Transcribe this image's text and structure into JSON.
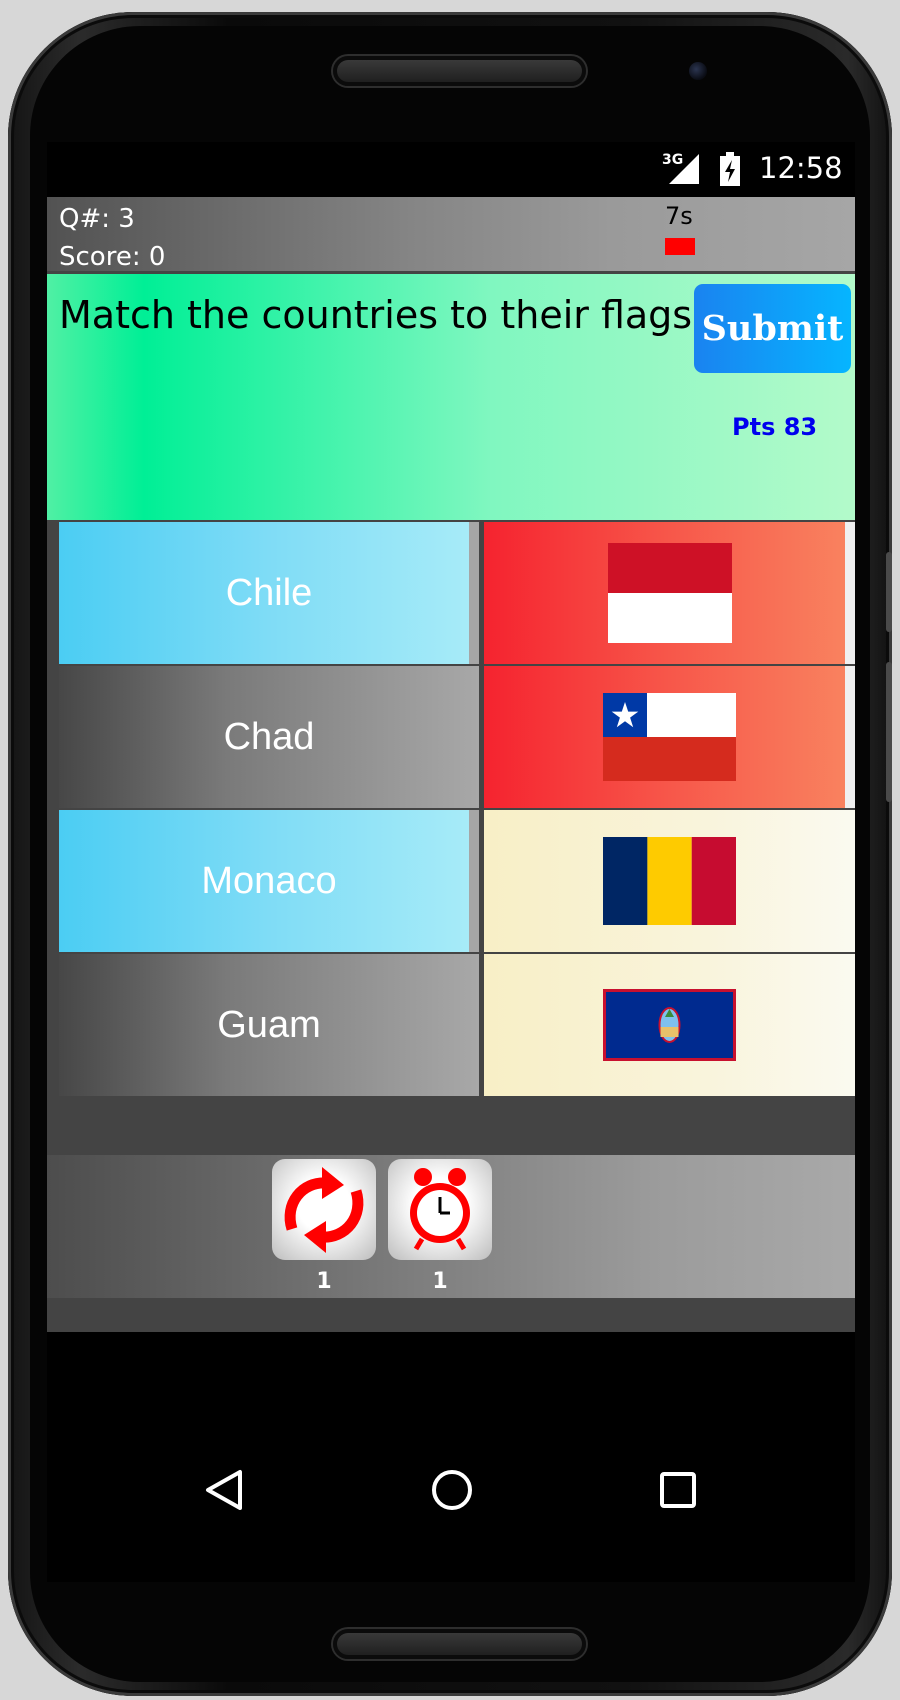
{
  "status_bar": {
    "network": "3G",
    "time": "12:58",
    "icons": [
      "signal-icon",
      "battery-charging-icon"
    ]
  },
  "header": {
    "question_number": "Q#: 3",
    "score": "Score: 0",
    "timer": "7s",
    "timer_color": "#ff0000"
  },
  "question": {
    "prompt": "Match the countries to their flags",
    "submit_label": "Submit",
    "points": "Pts 83"
  },
  "rows": [
    {
      "country": "Chile",
      "flag": "indonesia-monaco-flag"
    },
    {
      "country": "Chad",
      "flag": "chile-flag"
    },
    {
      "country": "Monaco",
      "flag": "chad-flag"
    },
    {
      "country": "Guam",
      "flag": "guam-flag"
    }
  ],
  "powerups": [
    {
      "icon": "refresh-icon",
      "count": "1"
    },
    {
      "icon": "alarm-clock-icon",
      "count": "1"
    }
  ],
  "nav": [
    "back-icon",
    "home-icon",
    "recents-icon"
  ],
  "colors": {
    "accent_green": "#00ef96",
    "submit_blue": "#06b5ff",
    "points_blue": "#0000ee",
    "selected_red": "#f5232f",
    "cell_blue": "#4bcdf3"
  }
}
